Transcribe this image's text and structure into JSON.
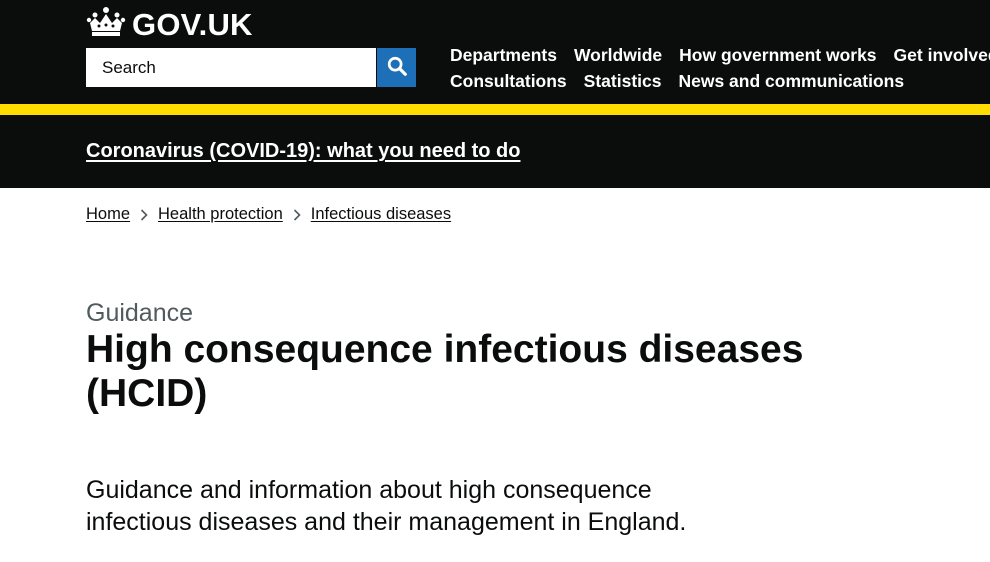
{
  "header": {
    "logo_text": "GOV.UK",
    "search": {
      "placeholder": "Search"
    },
    "nav": {
      "row1": [
        "Departments",
        "Worldwide",
        "How government works",
        "Get involved"
      ],
      "row2": [
        "Consultations",
        "Statistics",
        "News and communications"
      ]
    }
  },
  "banner": {
    "link_text": "Coronavirus (COVID-19): what you need to do"
  },
  "breadcrumb": [
    "Home",
    "Health protection",
    "Infectious diseases"
  ],
  "page": {
    "caption": "Guidance",
    "title_line1": "High consequence infectious diseases",
    "title_line2": "(HCID)",
    "lead_line1": "Guidance and information about high consequence",
    "lead_line2": "infectious diseases and their management in England."
  },
  "colors": {
    "header_bg": "#0b0c0c",
    "accent_yellow": "#ffdd00",
    "search_button": "#1d70b8",
    "caption_grey": "#505a5f"
  },
  "icons": {
    "logo": "crown-icon",
    "search": "magnifier-icon",
    "breadcrumb_separator": "chevron-right-icon"
  }
}
